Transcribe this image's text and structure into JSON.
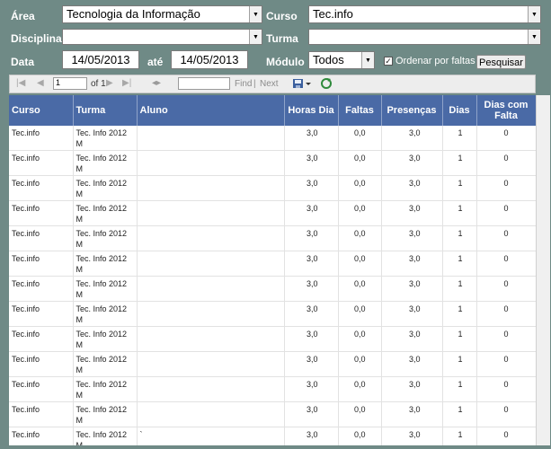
{
  "filters": {
    "area_label": "Área",
    "area_value": "Tecnologia da Informação",
    "curso_label": "Curso",
    "curso_value": "Tec.info",
    "disciplina_label": "Disciplina",
    "disciplina_value": "",
    "turma_label": "Turma",
    "turma_value": "",
    "data_label": "Data",
    "data_from": "14/05/2013",
    "ate_label": "até",
    "data_to": "14/05/2013",
    "modulo_label": "Módulo",
    "modulo_value": "Todos",
    "ordenar_label": "Ordenar por faltas",
    "ordenar_checked": "✓",
    "pesquisar_label": "Pesquisar"
  },
  "toolbar": {
    "page_value": "1",
    "of_text": "of 1",
    "find_label": "Find",
    "separator": "|",
    "next_label": "Next"
  },
  "table": {
    "headers": [
      "Curso",
      "Turma",
      "Aluno",
      "Horas Dia",
      "Faltas",
      "Presenças",
      "Dias",
      "Dias com Falta"
    ],
    "rows": [
      [
        "Tec.info",
        "Tec. Info 2012 M",
        "",
        "3,0",
        "0,0",
        "3,0",
        "1",
        "0"
      ],
      [
        "Tec.info",
        "Tec. Info 2012 M",
        "",
        "3,0",
        "0,0",
        "3,0",
        "1",
        "0"
      ],
      [
        "Tec.info",
        "Tec. Info 2012 M",
        "",
        "3,0",
        "0,0",
        "3,0",
        "1",
        "0"
      ],
      [
        "Tec.info",
        "Tec. Info 2012 M",
        "",
        "3,0",
        "0,0",
        "3,0",
        "1",
        "0"
      ],
      [
        "Tec.info",
        "Tec. Info 2012 M",
        "",
        "3,0",
        "0,0",
        "3,0",
        "1",
        "0"
      ],
      [
        "Tec.info",
        "Tec. Info 2012 M",
        "",
        "3,0",
        "0,0",
        "3,0",
        "1",
        "0"
      ],
      [
        "Tec.info",
        "Tec. Info 2012 M",
        "",
        "3,0",
        "0,0",
        "3,0",
        "1",
        "0"
      ],
      [
        "Tec.info",
        "Tec. Info 2012 M",
        "",
        "3,0",
        "0,0",
        "3,0",
        "1",
        "0"
      ],
      [
        "Tec.info",
        "Tec. Info 2012 M",
        "",
        "3,0",
        "0,0",
        "3,0",
        "1",
        "0"
      ],
      [
        "Tec.info",
        "Tec. Info 2012 M",
        "",
        "3,0",
        "0,0",
        "3,0",
        "1",
        "0"
      ],
      [
        "Tec.info",
        "Tec. Info 2012 M",
        "",
        "3,0",
        "0,0",
        "3,0",
        "1",
        "0"
      ],
      [
        "Tec.info",
        "Tec. Info 2012 M",
        "",
        "3,0",
        "0,0",
        "3,0",
        "1",
        "0"
      ],
      [
        "Tec.info",
        "Tec. Info 2012 M",
        "`",
        "3,0",
        "0,0",
        "3,0",
        "1",
        "0"
      ]
    ]
  }
}
